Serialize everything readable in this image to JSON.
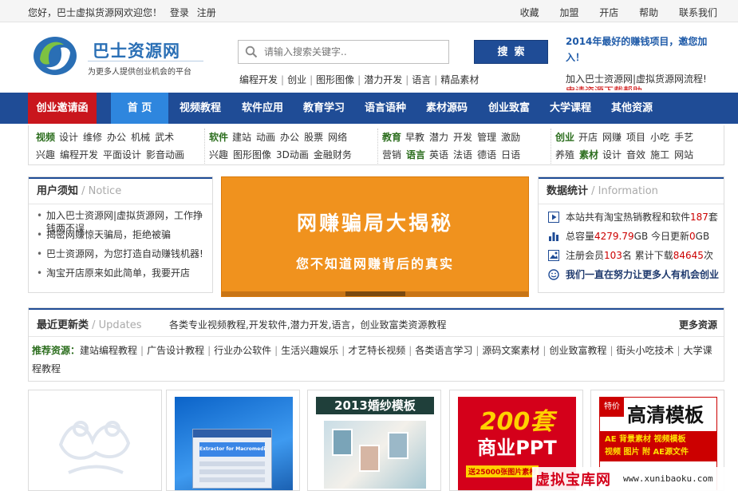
{
  "topbar": {
    "welcome": "您好，巴士虚拟货源网欢迎您！",
    "login": "登录",
    "register": "注册",
    "links": [
      "收藏",
      "加盟",
      "开店",
      "帮助",
      "联系我们"
    ]
  },
  "header": {
    "logo_title": "巴士资源网",
    "logo_sub": "为更多人提供创业机会的平台",
    "search_placeholder": "请输入搜索关键字..",
    "search_button": "搜索",
    "hotwords": [
      "编程开发",
      "创业",
      "图形图像",
      "潜力开发",
      "语言",
      "精品素材"
    ],
    "promo_title": "2014年最好的赚钱项目，邀您加入！",
    "promo_line": "加入巴士资源网|虚拟货源网流程!",
    "promo_red": "申请资源下载帮助"
  },
  "nav": [
    "创业邀请函",
    "首 页",
    "视频教程",
    "软件应用",
    "教育学习",
    "语言语种",
    "素材源码",
    "创业致富",
    "大学课程",
    "其他资源"
  ],
  "categories": [
    {
      "row1_head": "视频",
      "row1": [
        "设计",
        "维修",
        "办公",
        "机械",
        "武术"
      ],
      "row2": [
        "兴趣",
        "编程开发",
        "平面设计",
        "影音动画"
      ]
    },
    {
      "row1_head": "软件",
      "row1": [
        "建站",
        "动画",
        "办公",
        "股票",
        "网络"
      ],
      "row2": [
        "兴趣",
        "图形图像",
        "3D动画",
        "金融财务"
      ]
    },
    {
      "row1_head": "教育",
      "row1": [
        "早教",
        "潜力",
        "开发",
        "管理",
        "激励"
      ],
      "row2": [
        "营销"
      ],
      "row2_head": "语言",
      "row2b": [
        "英语",
        "法语",
        "德语",
        "日语"
      ]
    },
    {
      "row1_head": "创业",
      "row1": [
        "开店",
        "网赚",
        "项目",
        "小吃",
        "手艺"
      ],
      "row2": [
        "养殖"
      ],
      "row2_head": "素材",
      "row2b": [
        "设计",
        "音效",
        "施工",
        "网站"
      ]
    }
  ],
  "notice": {
    "title": "用户须知",
    "title_en": "/ Notice",
    "items": [
      "加入巴士资源网|虚拟货源网，工作挣钱两不误",
      "揭密网赚惊天骗局，拒绝被骗",
      "巴士资源网，为您打造自动赚钱机器!",
      "淘宝开店原来如此简单，我要开店"
    ]
  },
  "banner": {
    "line1": "网赚骗局大揭秘",
    "line2": "您不知道网赚背后的真实"
  },
  "stats": {
    "title": "数据统计",
    "title_en": "/ Information",
    "r1_pre": "本站共有淘宝热销教程和软件",
    "r1_num": "187",
    "r1_post": "套",
    "r2_pre": "总容量",
    "r2_num": "4279.79",
    "r2_mid": "GB 今日更新",
    "r2_num2": "0",
    "r2_post": "GB",
    "r3_pre": "注册会员",
    "r3_num": "103",
    "r3_mid": "名 累计下载",
    "r3_num2": "84645",
    "r3_post": "次",
    "r4": "我们一直在努力让更多人有机会创业"
  },
  "updates": {
    "title": "最近更新类",
    "title_en": "/ Updates",
    "desc": "各类专业视频教程,开发软件,潜力开发,语言，创业致富类资源教程",
    "more": "更多资源",
    "rec_label": "推荐资源：",
    "rec": [
      "建站编程教程",
      "广告设计教程",
      "行业办公软件",
      "生活兴趣娱乐",
      "才艺特长视频",
      "各类语言学习",
      "源码文案素材",
      "创业致富教程",
      "街头小吃技术",
      "大学课程教程"
    ]
  },
  "thumbs": {
    "t2_banner": "Extractor for Macromedia products",
    "t3_title": "2013婚纱模板",
    "t4_num": "200套",
    "t4_txt": "商业PPT",
    "t4_sub": "送25000张图片素材",
    "t5_tag": "特价",
    "t5_title": "高清模板",
    "t5_line1": "AE 背景素材  视频模板",
    "t5_line2": "视频 图片 附 AE源文件"
  },
  "watermark": {
    "cn": "虚拟宝库网",
    "url": "www.xunibaoku.com"
  },
  "colors": {
    "nav_bg": "#1f4c96",
    "nav_red": "#c9161d",
    "nav_active": "#2e86de",
    "banner": "#f0921e",
    "accent_red": "#cc0000"
  }
}
